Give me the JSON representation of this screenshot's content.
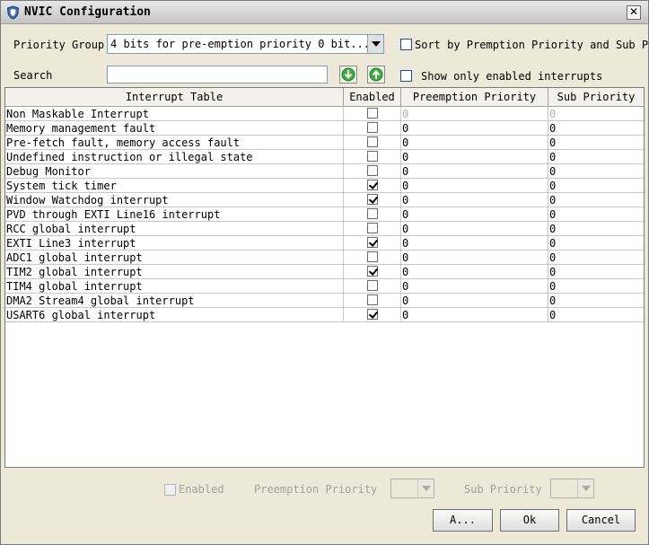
{
  "window": {
    "title": "NVIC Configuration",
    "close_glyph": "✕"
  },
  "priority_group": {
    "label": "Priority Group",
    "value": "4 bits for pre-emption priority 0 bit..."
  },
  "sort": {
    "label": "Sort by Premption Priority and Sub Pr",
    "checked": false
  },
  "search": {
    "label": "Search",
    "value": ""
  },
  "show_enabled": {
    "label": "Show only enabled interrupts",
    "checked": false
  },
  "table": {
    "headers": [
      "Interrupt Table",
      "Enabled",
      "Preemption Priority",
      "Sub Priority"
    ],
    "rows": [
      {
        "name": "Non Maskable Interrupt",
        "enabled": false,
        "preemption": "0",
        "sub": "0",
        "muted": true
      },
      {
        "name": "Memory management fault",
        "enabled": false,
        "preemption": "0",
        "sub": "0",
        "muted": false
      },
      {
        "name": "Pre-fetch fault, memory access fault",
        "enabled": false,
        "preemption": "0",
        "sub": "0",
        "muted": false
      },
      {
        "name": "Undefined instruction or illegal state",
        "enabled": false,
        "preemption": "0",
        "sub": "0",
        "muted": false
      },
      {
        "name": "Debug Monitor",
        "enabled": false,
        "preemption": "0",
        "sub": "0",
        "muted": false
      },
      {
        "name": "System tick timer",
        "enabled": true,
        "preemption": "0",
        "sub": "0",
        "muted": false
      },
      {
        "name": "Window Watchdog interrupt",
        "enabled": true,
        "preemption": "0",
        "sub": "0",
        "muted": false
      },
      {
        "name": "PVD through EXTI Line16 interrupt",
        "enabled": false,
        "preemption": "0",
        "sub": "0",
        "muted": false
      },
      {
        "name": "RCC global interrupt",
        "enabled": false,
        "preemption": "0",
        "sub": "0",
        "muted": false
      },
      {
        "name": "EXTI Line3 interrupt",
        "enabled": true,
        "preemption": "0",
        "sub": "0",
        "muted": false
      },
      {
        "name": "ADC1 global interrupt",
        "enabled": false,
        "preemption": "0",
        "sub": "0",
        "muted": false
      },
      {
        "name": "TIM2 global interrupt",
        "enabled": true,
        "preemption": "0",
        "sub": "0",
        "muted": false
      },
      {
        "name": "TIM4 global interrupt",
        "enabled": false,
        "preemption": "0",
        "sub": "0",
        "muted": false
      },
      {
        "name": "DMA2 Stream4 global interrupt",
        "enabled": false,
        "preemption": "0",
        "sub": "0",
        "muted": false
      },
      {
        "name": "USART6 global interrupt",
        "enabled": true,
        "preemption": "0",
        "sub": "0",
        "muted": false
      }
    ]
  },
  "bottom": {
    "enabled_label": "Enabled",
    "preemption_label": "Preemption Priority",
    "sub_label": "Sub Priority",
    "preemption_value": "",
    "sub_value": ""
  },
  "buttons": {
    "apply": "A...",
    "ok": "Ok",
    "cancel": "Cancel"
  },
  "colors": {
    "background": "#ece9d8",
    "arrow_green": "#2f9a2f"
  },
  "icons": {
    "title": "shield-icon",
    "down": "arrow-down-icon",
    "up": "arrow-up-icon"
  }
}
